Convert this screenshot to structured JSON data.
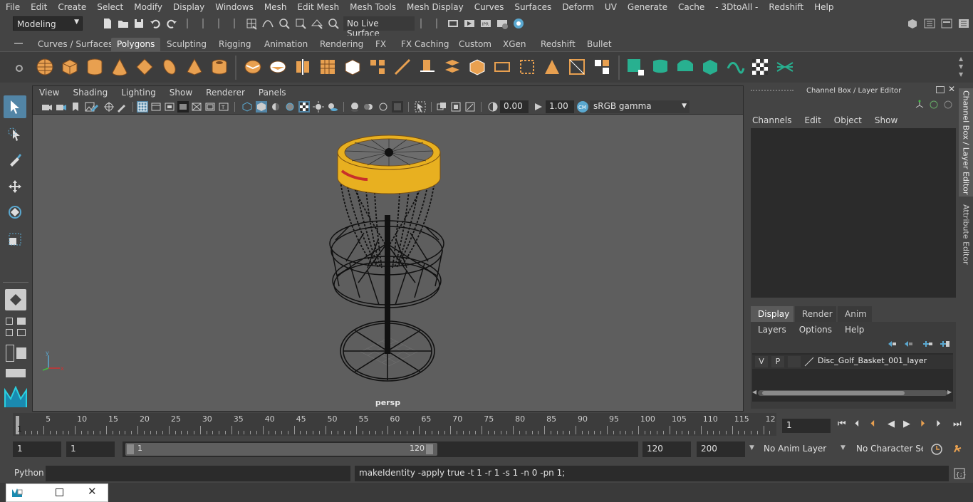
{
  "menubar": [
    "File",
    "Edit",
    "Create",
    "Select",
    "Modify",
    "Display",
    "Windows",
    "Mesh",
    "Edit Mesh",
    "Mesh Tools",
    "Mesh Display",
    "Curves",
    "Surfaces",
    "Deform",
    "UV",
    "Generate",
    "Cache",
    "- 3DtoAll -",
    "Redshift",
    "Help"
  ],
  "statusline": {
    "mode": "Modeling",
    "live_surface": "No Live Surface"
  },
  "shelf_tabs": [
    "Curves / Surfaces",
    "Polygons",
    "Sculpting",
    "Rigging",
    "Animation",
    "Rendering",
    "FX",
    "FX Caching",
    "Custom",
    "XGen",
    "Redshift",
    "Bullet"
  ],
  "active_shelf_tab": "Polygons",
  "viewport": {
    "menu": [
      "View",
      "Shading",
      "Lighting",
      "Show",
      "Renderer",
      "Panels"
    ],
    "exposure": "0.00",
    "gamma": "1.00",
    "color_space": "sRGB gamma",
    "camera": "persp"
  },
  "channel_box": {
    "title": "Channel Box / Layer Editor",
    "menu": [
      "Channels",
      "Edit",
      "Object",
      "Show"
    ]
  },
  "layer_editor": {
    "tabs": [
      "Display",
      "Render",
      "Anim"
    ],
    "active_tab": "Display",
    "menu": [
      "Layers",
      "Options",
      "Help"
    ],
    "layers": [
      {
        "v": "V",
        "p": "P",
        "name": "Disc_Golf_Basket_001_layer"
      }
    ]
  },
  "side_tabs": [
    "Channel Box / Layer Editor",
    "Attribute Editor"
  ],
  "timeline": {
    "ticks": [
      "5",
      "10",
      "15",
      "20",
      "25",
      "30",
      "35",
      "40",
      "45",
      "50",
      "55",
      "60",
      "65",
      "70",
      "75",
      "80",
      "85",
      "90",
      "95",
      "100",
      "105",
      "110",
      "115",
      "12"
    ],
    "start_label": "1",
    "current_frame": "1"
  },
  "range": {
    "start": "1",
    "playback_start": "1",
    "slider_start": "1",
    "slider_end": "120",
    "playback_end": "120",
    "end": "200",
    "anim_layer": "No Anim Layer",
    "character_set": "No Character Set"
  },
  "cmdline": {
    "language": "Python",
    "output": "makeIdentity -apply true -t 1 -r 1 -s 1 -n 0 -pn 1;"
  },
  "colors": {
    "accent": "#5285a6",
    "rim_yellow": "#e8b020",
    "shelf_orange": "#e8a050",
    "shelf_teal": "#28b090"
  }
}
